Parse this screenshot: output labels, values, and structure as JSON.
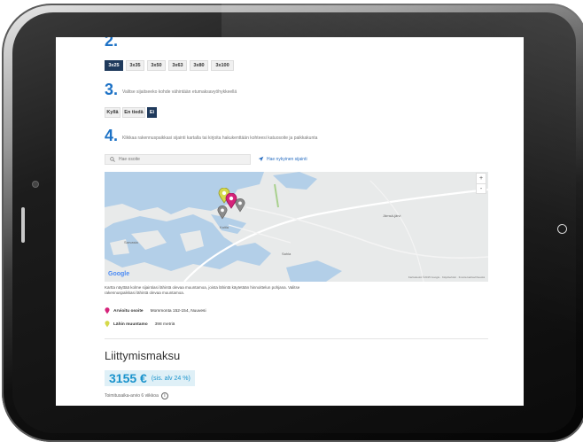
{
  "colors": {
    "accent": "#1d72c6",
    "selected": "#1f3a5c",
    "price": "#1a93cc",
    "price_bg": "#dff0f7"
  },
  "step2": {
    "number": "2.",
    "text": "",
    "options": [
      {
        "label": "3x25",
        "selected": true
      },
      {
        "label": "3x35",
        "selected": false
      },
      {
        "label": "3x50",
        "selected": false
      },
      {
        "label": "3x63",
        "selected": false
      },
      {
        "label": "3x80",
        "selected": false
      },
      {
        "label": "3x100",
        "selected": false
      }
    ]
  },
  "step3": {
    "number": "3.",
    "text": "Valitse sijaitseeko kohde vähintään etumaksavyöhykkeellä",
    "options": [
      {
        "label": "Kyllä",
        "selected": false
      },
      {
        "label": "En tiedä",
        "selected": false
      },
      {
        "label": "Ei",
        "selected": true
      }
    ]
  },
  "step4": {
    "number": "4.",
    "text": "Klikkaa rakennuspaikkasi sijainti kartalla tai kirjoita hakukenttään kohteesi katuosoite ja paikkakunta",
    "search_placeholder": "Hae osoite",
    "search_icon": "search-icon",
    "locate_label": "Hae nykyinen sijainti",
    "locate_icon": "location-arrow-icon"
  },
  "map": {
    "zoom_in": "+",
    "zoom_out": "-",
    "provider": "Google",
    "attribution": "Karttatiedot ©2015 Google · Käyttöehdot · Ilmoita karttavirheestä",
    "place_labels": [
      "Jämsä-järvi",
      "Sarvasta",
      "Sahla",
      "Kaitla"
    ]
  },
  "map_note": "Kartta näyttää kolme sijaintiasi lähintä olevaa muuntamoa, joista lähintä käytetään hinnoittelun pohjana. Valitse rakennuspaikkasi lähintä olevaa muuntamoa.",
  "legend": {
    "address_label": "Arvioitu osoite",
    "address_value": "Mommonta 152-154, Nuuvesi",
    "station_label": "Lähin muuntamo",
    "station_value": "398 metriä"
  },
  "fee": {
    "title": "Liittymismaksu",
    "price": "3155 €",
    "vat": "(sis. alv 24 %)",
    "delivery": "Toimitusaika-arvio 6 viikkoa",
    "info_icon": "info-icon"
  }
}
